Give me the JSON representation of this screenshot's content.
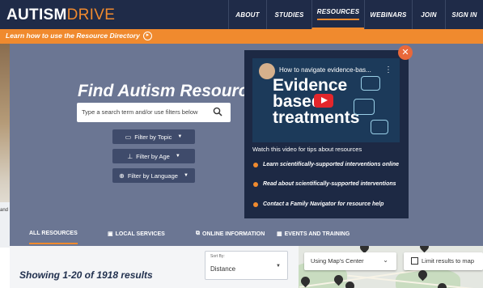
{
  "header": {
    "logo_part1": "AUTISM",
    "logo_part2": "DRIVE",
    "nav": [
      "ABOUT",
      "STUDIES",
      "RESOURCES",
      "WEBINARS",
      "JOIN",
      "SIGN IN"
    ],
    "active_nav": "RESOURCES"
  },
  "banner": {
    "text": "Learn how to use the Resource Directory",
    "icon": "circle-arrow-right-icon"
  },
  "left_fragment": {
    "text": "and"
  },
  "hero": {
    "title": "Find Autism Resources",
    "search_placeholder": "Type a search term and/or use filters below",
    "filters": [
      "Filter by Topic",
      "Filter by Age",
      "Filter by Language"
    ]
  },
  "video_card": {
    "video_title": "How to navigate evidence-bas...",
    "video_big_text": [
      "Evidence",
      "based",
      "treatments"
    ],
    "caption": "Watch this video for tips about resources",
    "links": [
      "Learn scientifically-supported interventions online",
      "Read about scientifically-supported interventions",
      "Contact a Family Navigator for resource help"
    ]
  },
  "tabs": [
    "ALL RESOURCES",
    "LOCAL SERVICES",
    "ONLINE INFORMATION",
    "EVENTS AND TRAINING"
  ],
  "results": {
    "showing": "Showing 1-20 of 1918 results",
    "sort_label": "Sort By:",
    "sort_value": "Distance"
  },
  "map": {
    "center_select": "Using Map's Center",
    "limit_label": "Limit results to map"
  },
  "colors": {
    "navy": "#1f2b48",
    "orange": "#f08a2e",
    "hero_bg": "#6b7693"
  }
}
